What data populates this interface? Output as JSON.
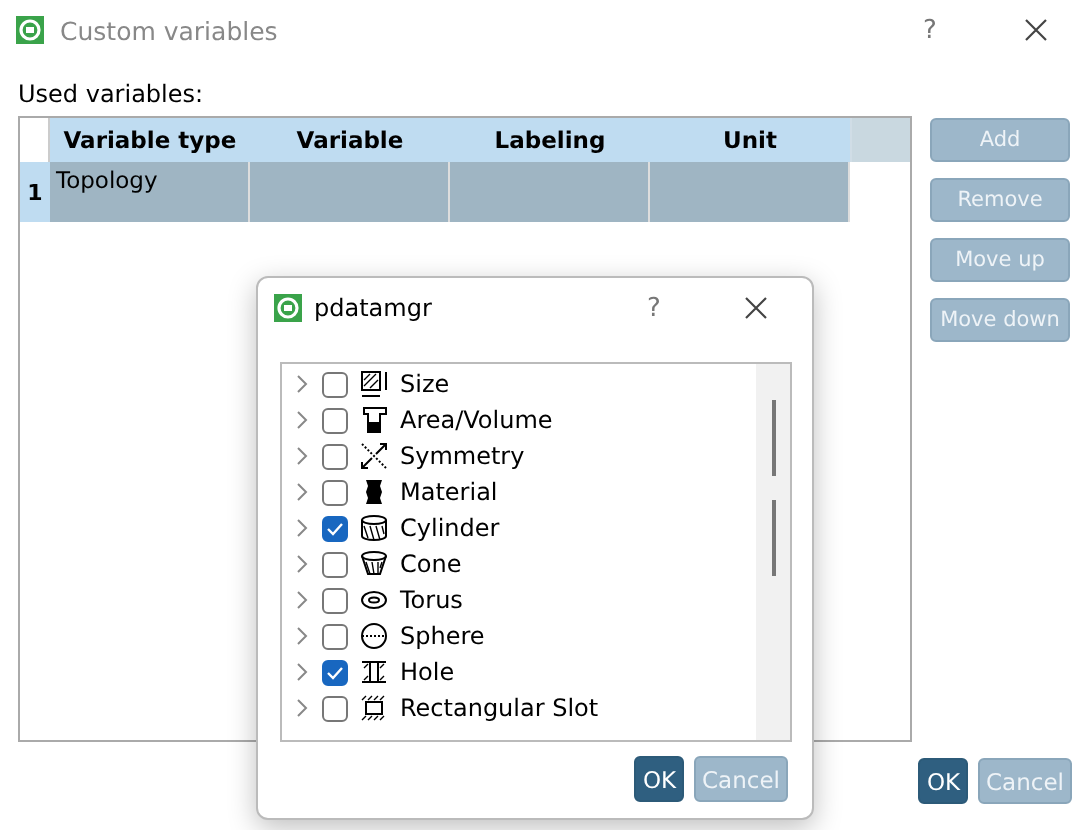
{
  "window": {
    "title": "Custom variables",
    "help": "?"
  },
  "used_label": "Used variables:",
  "table": {
    "columns": [
      "Variable type",
      "Variable",
      "Labeling",
      "Unit"
    ],
    "rows": [
      {
        "number": "1",
        "cells": [
          "Topology",
          "",
          "",
          ""
        ],
        "selected": true
      }
    ]
  },
  "side_buttons": [
    {
      "label": "Add",
      "disabled": true
    },
    {
      "label": "Remove",
      "disabled": true
    },
    {
      "label": "Move up",
      "disabled": true
    },
    {
      "label": "Move down",
      "disabled": true
    }
  ],
  "buttons": [
    {
      "label": "OK",
      "disabled": false
    },
    {
      "label": "Cancel",
      "disabled": true
    }
  ],
  "dialog": {
    "title": "pdatamgr",
    "help": "?",
    "items": [
      {
        "label": "Size",
        "checked": false,
        "kind": "size"
      },
      {
        "label": "Area/Volume",
        "checked": false,
        "kind": "area"
      },
      {
        "label": "Symmetry",
        "checked": false,
        "kind": "symmetry"
      },
      {
        "label": "Material",
        "checked": false,
        "kind": "material"
      },
      {
        "label": "Cylinder",
        "checked": true,
        "kind": "cylinder"
      },
      {
        "label": "Cone",
        "checked": false,
        "kind": "cone"
      },
      {
        "label": "Torus",
        "checked": false,
        "kind": "torus"
      },
      {
        "label": "Sphere",
        "checked": false,
        "kind": "sphere"
      },
      {
        "label": "Hole",
        "checked": true,
        "kind": "hole"
      },
      {
        "label": "Rectangular Slot",
        "checked": false,
        "kind": "slot"
      }
    ],
    "buttons": [
      {
        "label": "OK",
        "disabled": false
      },
      {
        "label": "Cancel",
        "disabled": true
      }
    ]
  }
}
